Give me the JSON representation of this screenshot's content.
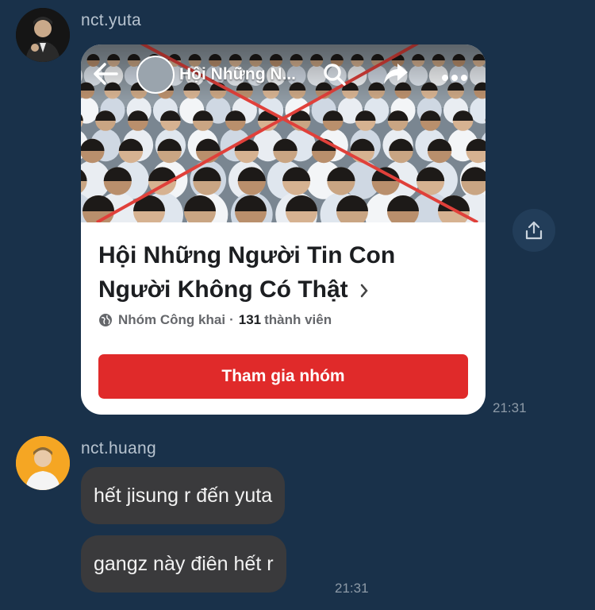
{
  "messages": [
    {
      "sender": "nct.yuta",
      "avatar_icon": "user-avatar-icon",
      "shared_group": {
        "cover_title": "Hội Những N...",
        "name": "Hội Những Người Tin Con Người Không Có Thật",
        "privacy": "Nhóm Công khai",
        "separator": "·",
        "member_count": "131",
        "member_label": "thành viên",
        "join_label": "Tham gia nhóm",
        "icons": [
          "back-arrow-icon",
          "search-icon",
          "share-arrow-icon",
          "more-icon",
          "globe-icon",
          "chevron-right-icon"
        ]
      },
      "time": "21:31"
    },
    {
      "sender": "nct.huang",
      "avatar_icon": "user-avatar-icon",
      "texts": [
        "hết jisung r đến yuta",
        "gangz này điên hết r"
      ],
      "time": "21:31"
    }
  ],
  "share_icon": "upload-share-icon",
  "colors": {
    "background": "#19314a",
    "bubble": "#3a3a3c",
    "join_button": "#e02a2a",
    "cross_lines": "#e0403a"
  }
}
